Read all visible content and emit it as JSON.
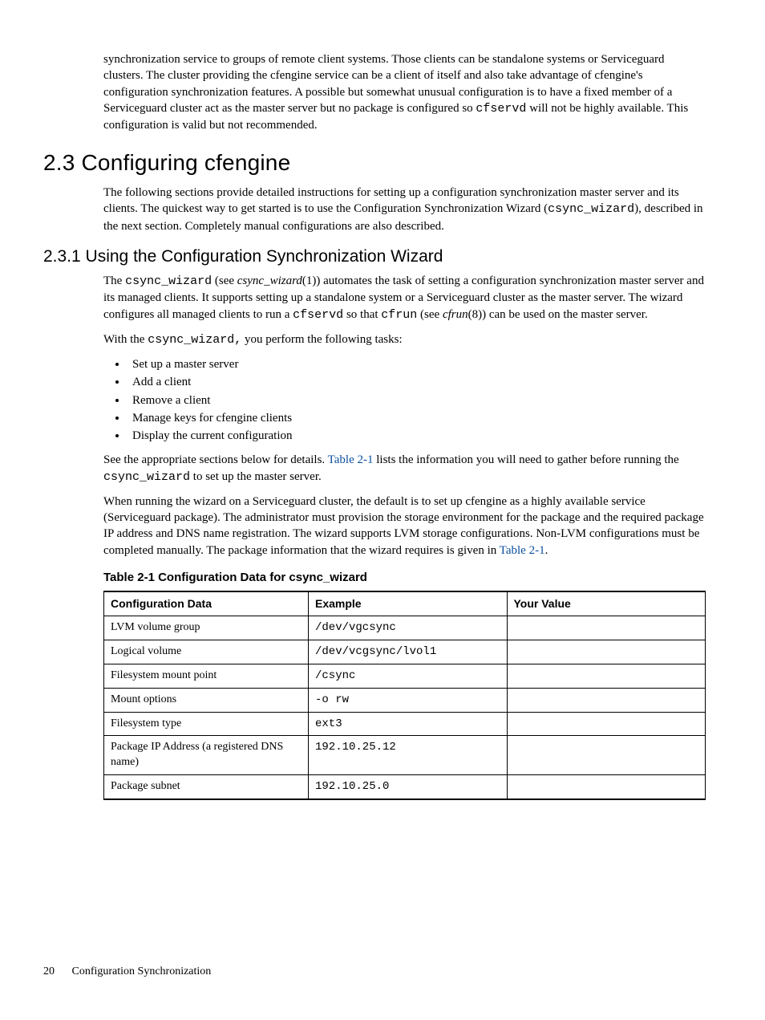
{
  "intro_para": {
    "t1": "synchronization service to groups of remote client systems. Those clients can be standalone systems or Serviceguard clusters. The cluster providing the cfengine service can be a client of itself and also take advantage of cfengine's configuration synchronization features. A possible but somewhat unusual configuration is to have a fixed member of a Serviceguard cluster act as the master server but no package is configured so ",
    "code1": "cfservd",
    "t2": " will not be highly available. This configuration is valid but not recommended."
  },
  "h1": "2.3 Configuring cfengine",
  "p1": {
    "t1": "The following sections provide detailed instructions for setting up a configuration synchronization master server and its clients. The quickest way to get started is to use the Configuration Synchronization Wizard (",
    "code1": "csync_wizard",
    "t2": "), described in the next section. Completely manual configurations are also described."
  },
  "h2": "2.3.1 Using the Configuration Synchronization Wizard",
  "p2": {
    "t1": "The ",
    "code1": "csync_wizard",
    "t2": " (see ",
    "ital1": "csync_wizard",
    "t3": "(1)) automates the task of setting a configuration synchronization master server and its managed clients. It supports setting up a standalone system or a Serviceguard cluster as the master server. The wizard configures all managed clients to run a ",
    "code2": "cfservd",
    "t4": " so that ",
    "code3": "cfrun",
    "t5": " (see ",
    "ital2": "cfrun",
    "t6": "(8)) can be used on the master server."
  },
  "p3": {
    "t1": "With the ",
    "code1": "csync_wizard,",
    "t2": " you perform the following tasks:"
  },
  "bullets": [
    "Set up a master server",
    "Add a client",
    "Remove a client",
    "Manage keys for cfengine clients",
    "Display the current configuration"
  ],
  "p4": {
    "t1": "See the appropriate sections below for details. ",
    "link1": "Table 2-1",
    "t2": " lists the information you will need to gather before running the ",
    "code1": "csync_wizard",
    "t3": " to set up the master server."
  },
  "p5": {
    "t1": "When running the wizard on a Serviceguard cluster, the default is to set up cfengine as a highly available service (Serviceguard package). The administrator must provision the storage environment for the package and the required package IP address and DNS name registration. The wizard supports LVM storage configurations. Non-LVM configurations must be completed manually. The package information that the wizard requires is given in ",
    "link1": "Table 2-1",
    "t2": "."
  },
  "table_caption": "Table 2-1 Configuration Data for csync_wizard",
  "table": {
    "headers": [
      "Configuration Data",
      "Example",
      "Your Value"
    ],
    "rows": [
      {
        "c0": "LVM volume group",
        "c1": "/dev/vgcsync",
        "c2": ""
      },
      {
        "c0": "Logical volume",
        "c1": "/dev/vcgsync/lvol1",
        "c2": ""
      },
      {
        "c0": "Filesystem mount point",
        "c1": "/csync",
        "c2": ""
      },
      {
        "c0": "Mount options",
        "c1": "-o rw",
        "c2": ""
      },
      {
        "c0": "Filesystem type",
        "c1": "ext3",
        "c2": ""
      },
      {
        "c0": "Package IP Address (a registered DNS name)",
        "c1": "192.10.25.12",
        "c2": ""
      },
      {
        "c0": "Package subnet",
        "c1": "192.10.25.0",
        "c2": ""
      }
    ]
  },
  "footer": {
    "page": "20",
    "title": "Configuration Synchronization"
  }
}
